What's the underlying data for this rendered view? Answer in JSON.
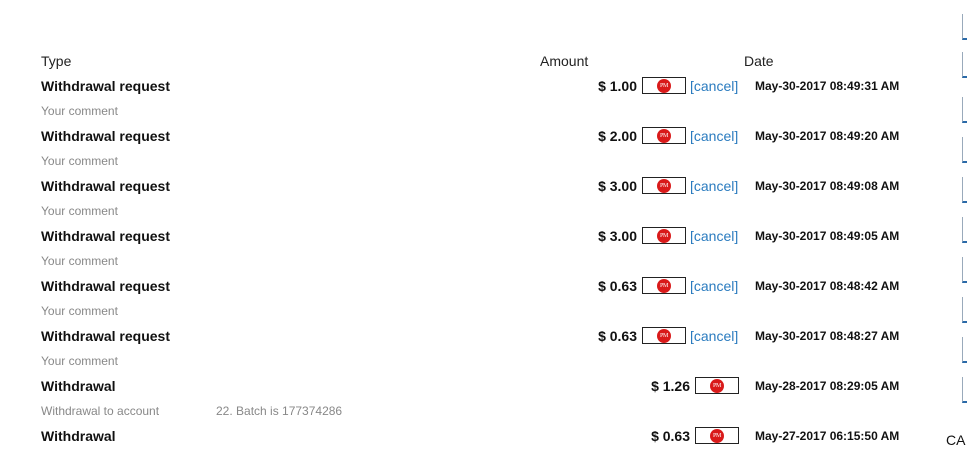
{
  "headers": {
    "type": "Type",
    "amount": "Amount",
    "date": "Date"
  },
  "rows": [
    {
      "type": "Withdrawal request",
      "amount": "$ 1.00",
      "pm": "PM",
      "cancel": "[cancel]",
      "date": "May-30-2017 08:49:31 AM",
      "comment": "Your comment"
    },
    {
      "type": "Withdrawal request",
      "amount": "$ 2.00",
      "pm": "PM",
      "cancel": "[cancel]",
      "date": "May-30-2017 08:49:20 AM",
      "comment": "Your comment"
    },
    {
      "type": "Withdrawal request",
      "amount": "$ 3.00",
      "pm": "PM",
      "cancel": "[cancel]",
      "date": "May-30-2017 08:49:08 AM",
      "comment": "Your comment"
    },
    {
      "type": "Withdrawal request",
      "amount": "$ 3.00",
      "pm": "PM",
      "cancel": "[cancel]",
      "date": "May-30-2017 08:49:05 AM",
      "comment": "Your comment"
    },
    {
      "type": "Withdrawal request",
      "amount": "$ 0.63",
      "pm": "PM",
      "cancel": "[cancel]",
      "date": "May-30-2017 08:48:42 AM",
      "comment": "Your comment"
    },
    {
      "type": "Withdrawal request",
      "amount": "$ 0.63",
      "pm": "PM",
      "cancel": "[cancel]",
      "date": "May-30-2017 08:48:27 AM",
      "comment": "Your comment"
    },
    {
      "type": "Withdrawal",
      "amount": "$ 1.26",
      "pm": "PM",
      "date": "May-28-2017 08:29:05 AM",
      "comment": "Withdrawal to account",
      "comment2": "22. Batch is 177374286"
    },
    {
      "type": "Withdrawal",
      "amount": "$ 0.63",
      "pm": "PM",
      "date": "May-27-2017 06:15:50 AM"
    }
  ],
  "side_text": "CA"
}
